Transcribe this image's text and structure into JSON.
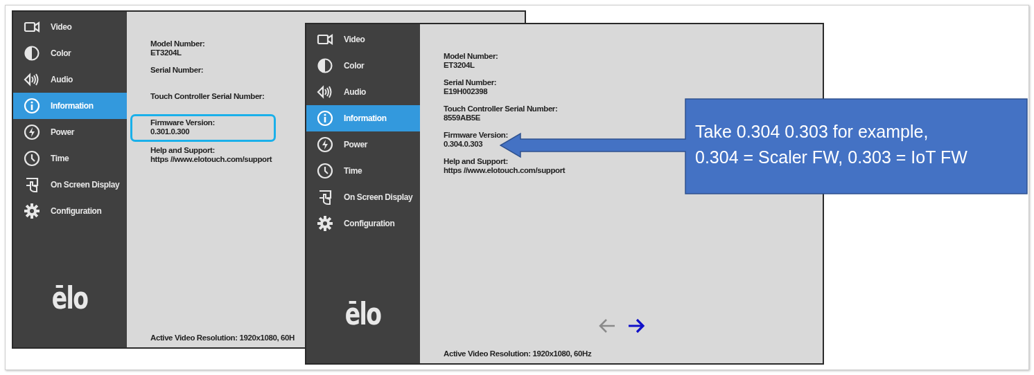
{
  "back_screen": {
    "menu": [
      {
        "label": "Video",
        "selected": false
      },
      {
        "label": "Color",
        "selected": false
      },
      {
        "label": "Audio",
        "selected": false
      },
      {
        "label": "Information",
        "selected": true
      },
      {
        "label": "Power",
        "selected": false
      },
      {
        "label": "Time",
        "selected": false
      },
      {
        "label": "On Screen Display",
        "selected": false
      },
      {
        "label": "Configuration",
        "selected": false
      }
    ],
    "logo": "ēlo",
    "info": [
      {
        "label": "Model Number:",
        "value": "ET3204L"
      },
      {
        "label": "Serial Number:"
      },
      {
        "label": "Touch Controller Serial Number:"
      },
      {
        "label": "Firmware Version:",
        "value": "0.301.0.300",
        "highlighted": true
      },
      {
        "label": "Help and Support:",
        "value": "https //www.elotouch.com/support"
      }
    ],
    "status": "Active Video Resolution:  1920x1080, 60H"
  },
  "front_screen": {
    "menu": [
      {
        "label": "Video",
        "selected": false
      },
      {
        "label": "Color",
        "selected": false
      },
      {
        "label": "Audio",
        "selected": false
      },
      {
        "label": "Information",
        "selected": true
      },
      {
        "label": "Power",
        "selected": false
      },
      {
        "label": "Time",
        "selected": false
      },
      {
        "label": "On Screen Display",
        "selected": false
      },
      {
        "label": "Configuration",
        "selected": false
      }
    ],
    "logo": "ēlo",
    "info": [
      {
        "label": "Model Number:",
        "value": "ET3204L"
      },
      {
        "label": "Serial Number:",
        "value": "E19H002398"
      },
      {
        "label": "Touch Controller Serial Number:",
        "value": "8559AB5E"
      },
      {
        "label": "Firmware Version:",
        "value": "0.304.0.303"
      },
      {
        "label": "Help and Support:",
        "value": "https //www.elotouch.com/support"
      }
    ],
    "nav": [
      {
        "kind": "back",
        "disabled": true
      },
      {
        "kind": "forward",
        "disabled": false
      }
    ],
    "status": "Active Video Resolution:  1920x1080, 60Hz"
  },
  "callout": {
    "lines": [
      "Take 0.304 0.303 for example,",
      "0.304 = Scaler FW, 0.303 = IoT FW"
    ]
  }
}
